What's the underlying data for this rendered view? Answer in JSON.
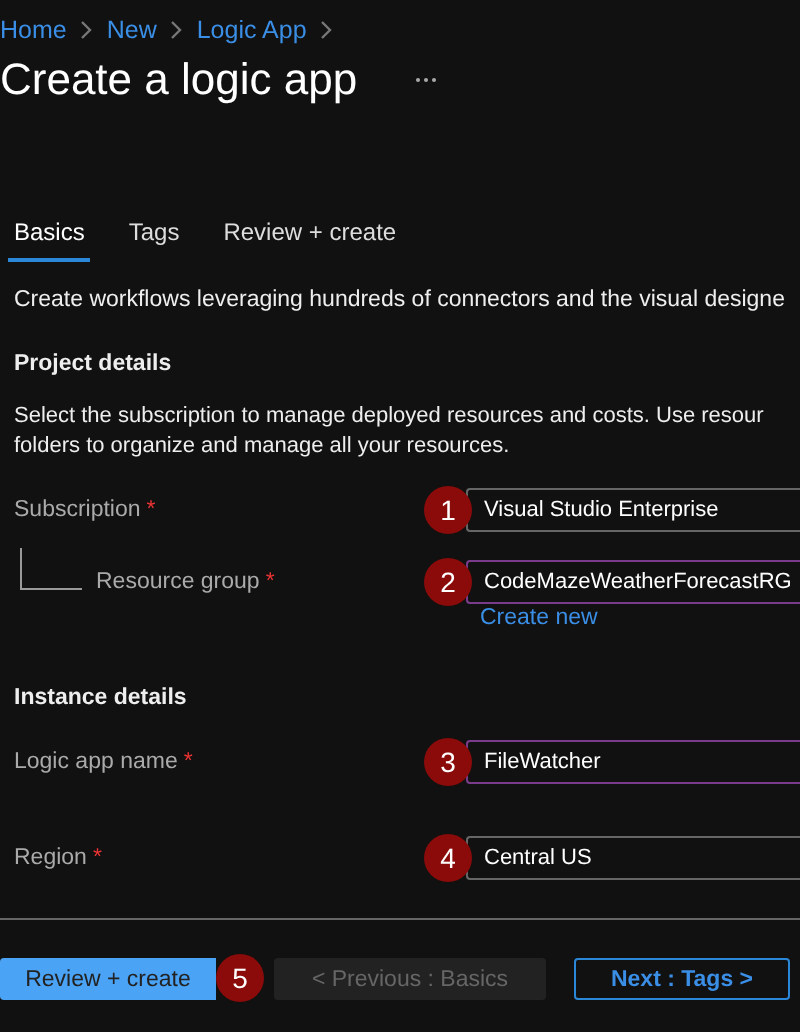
{
  "breadcrumb": [
    "Home",
    "New",
    "Logic App"
  ],
  "title": "Create a logic app",
  "tabs": [
    {
      "label": "Basics",
      "selected": true
    },
    {
      "label": "Tags",
      "selected": false
    },
    {
      "label": "Review + create",
      "selected": false
    }
  ],
  "description": "Create workflows leveraging hundreds of connectors and the visual designe",
  "sections": [
    {
      "heading": "Project details",
      "lines": [
        "Select the subscription to manage deployed resources and costs. Use resour",
        "folders to organize and manage all your resources."
      ],
      "fields": [
        {
          "label": "Subscription",
          "mark": "*",
          "value": "Visual Studio Enterprise",
          "badge": "1",
          "focused": false,
          "children": [
            {
              "label": "Resource group",
              "mark": "*",
              "value": "CodeMazeWeatherForecastRG",
              "badge": "2",
              "focused": true,
              "link": "Create new"
            }
          ]
        }
      ]
    },
    {
      "heading": "Instance details",
      "fields": [
        {
          "label": "Logic app name",
          "mark": "*",
          "value": "FileWatcher",
          "badge": "3",
          "focused": true
        },
        {
          "label": "Region",
          "mark": "*",
          "value": "Central US",
          "badge": "4",
          "focused": false
        }
      ]
    }
  ],
  "buttons": [
    {
      "label": "Review + create",
      "kind": "primary",
      "badge": "5"
    },
    {
      "label": "< Previous : Basics",
      "kind": "disabled"
    },
    {
      "label": "Next : Tags >",
      "kind": "outline"
    }
  ]
}
